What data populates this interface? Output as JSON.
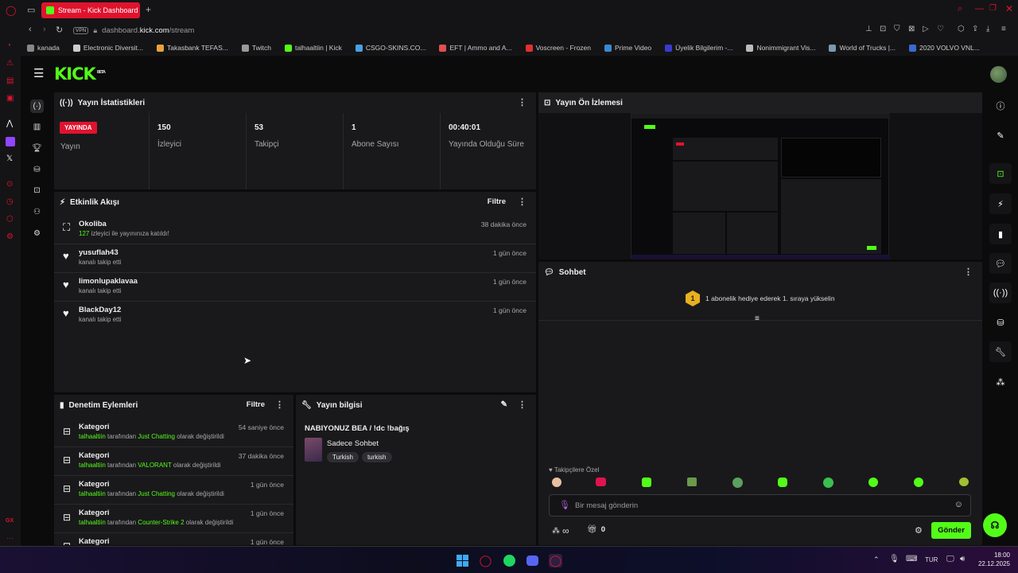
{
  "browser": {
    "tab_title": "Stream - Kick Dashboard",
    "url_prefix": "dashboard.",
    "url_host": "kick.com",
    "url_path": "/stream",
    "vpn": "VPN",
    "bookmarks": [
      {
        "label": "kanada",
        "color": "#888888"
      },
      {
        "label": "Electronic Diversit...",
        "color": "#cccccc"
      },
      {
        "label": "Takasbank TEFAS...",
        "color": "#e8a23a"
      },
      {
        "label": "Twitch",
        "color": "#999999"
      },
      {
        "label": "talhaaltiin | Kick",
        "color": "#53fc18"
      },
      {
        "label": "CSGO-SKINS.CO...",
        "color": "#4aa0e0"
      },
      {
        "label": "EFT | Ammo and A...",
        "color": "#e05050"
      },
      {
        "label": "Voscreen - Frozen",
        "color": "#e03030"
      },
      {
        "label": "Prime Video",
        "color": "#3a8ad0"
      },
      {
        "label": "Üyelik Bilgilerim -...",
        "color": "#3a3ad0"
      },
      {
        "label": "Nonimmigrant Vis...",
        "color": "#bbbbbb"
      },
      {
        "label": "World of Trucks |...",
        "color": "#7a9ab0"
      },
      {
        "label": "2020 VOLVO VNL...",
        "color": "#3a6ad0"
      }
    ]
  },
  "kick": {
    "logo": "KICK",
    "beta": "BETA"
  },
  "stats": {
    "title": "Yayın İstatistikleri",
    "live_badge": "YAYINDA",
    "live_label": "Yayın",
    "viewers_value": "150",
    "viewers_label": "İzleyici",
    "followers_value": "53",
    "followers_label": "Takipçi",
    "subs_value": "1",
    "subs_label": "Abone Sayısı",
    "duration_value": "00:40:01",
    "duration_label": "Yayında Olduğu Süre"
  },
  "activity": {
    "title": "Etkinlik Akışı",
    "filter": "Filtre",
    "items": [
      {
        "name": "Okoliba",
        "highlight": "127",
        "desc": " izleyici ile yayınınıza katıldı!",
        "time": "38 dakika önce"
      },
      {
        "name": "yusuflah43",
        "highlight": "",
        "desc": "kanalı takip etti",
        "time": "1 gün önce"
      },
      {
        "name": "limonlupaklavaa",
        "highlight": "",
        "desc": "kanalı takip etti",
        "time": "1 gün önce"
      },
      {
        "name": "BlackDay12",
        "highlight": "",
        "desc": "kanalı takip etti",
        "time": "1 gün önce"
      }
    ]
  },
  "moderation": {
    "title": "Denetim Eylemleri",
    "filter": "Filtre",
    "items": [
      {
        "title": "Kategori",
        "user": "talhaaltiin",
        "mid": " tarafından ",
        "cat": "Just Chatting",
        "end": " olarak değiştirildi",
        "time": "54 saniye önce"
      },
      {
        "title": "Kategori",
        "user": "talhaaltiin",
        "mid": " tarafından ",
        "cat": "VALORANT",
        "end": " olarak değiştirildi",
        "time": "37 dakika önce"
      },
      {
        "title": "Kategori",
        "user": "talhaaltiin",
        "mid": " tarafından ",
        "cat": "Just Chatting",
        "end": " olarak değiştirildi",
        "time": "1 gün önce"
      },
      {
        "title": "Kategori",
        "user": "talhaaltiin",
        "mid": " tarafından ",
        "cat": "Counter-Strike 2",
        "end": " olarak değiştirildi",
        "time": "1 gün önce"
      },
      {
        "title": "Kategori",
        "time": "1 gün önce"
      }
    ]
  },
  "streaminfo": {
    "title": "Yayın bilgisi",
    "stream_title": "NABIYONUZ BEA / !dc !bağış",
    "category": "Sadece Sohbet",
    "tags": [
      "Turkish",
      "turkish"
    ]
  },
  "preview": {
    "title": "Yayın Ön İzlemesi"
  },
  "chat": {
    "title": "Sohbet",
    "badge_number": "1",
    "promo": "1 abonelik hediye ederek 1. sıraya yükselin",
    "followers_only": "Takipçilere Özel",
    "input_placeholder": "Bir mesaj gönderin",
    "infinity": "∞",
    "gift_count": "0",
    "send": "Gönder"
  },
  "taskbar": {
    "lang": "TUR",
    "time": "18:00",
    "date": "22.12.2025"
  },
  "colors": {
    "accent": "#53fc18",
    "live": "#e0132e"
  }
}
